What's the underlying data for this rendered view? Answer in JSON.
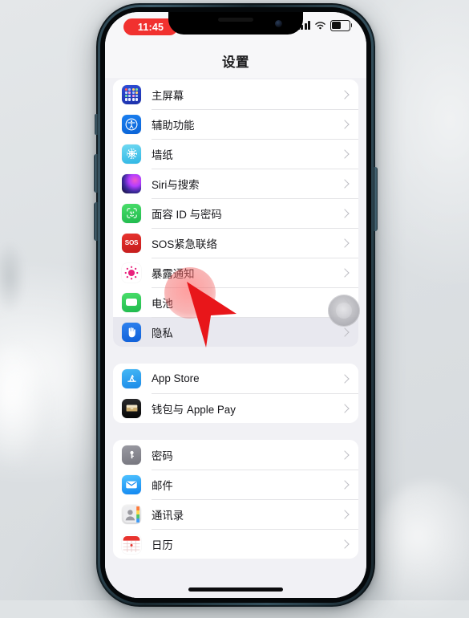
{
  "statusbar": {
    "time": "11:45",
    "time_pill_color": "#f1312f",
    "signal_icon": "cellular-signal-icon",
    "wifi_icon": "wifi-icon",
    "battery_icon": "battery-icon"
  },
  "navbar": {
    "title": "设置"
  },
  "groups": [
    {
      "name": "group-display",
      "rows": [
        {
          "label": "主屏幕",
          "icon": "home-screen-icon"
        },
        {
          "label": "辅助功能",
          "icon": "accessibility-icon"
        },
        {
          "label": "墙纸",
          "icon": "wallpaper-icon"
        },
        {
          "label": "Siri与搜索",
          "icon": "siri-icon"
        },
        {
          "label": "面容 ID 与密码",
          "icon": "face-id-icon"
        },
        {
          "label": "SOS紧急联络",
          "icon": "sos-icon"
        },
        {
          "label": "暴露通知",
          "icon": "exposure-notification-icon"
        },
        {
          "label": "电池",
          "icon": "battery-settings-icon"
        },
        {
          "label": "隐私",
          "icon": "privacy-icon",
          "pressed": true
        }
      ]
    },
    {
      "name": "group-store",
      "rows": [
        {
          "label": "App Store",
          "icon": "app-store-icon"
        },
        {
          "label": "钱包与 Apple Pay",
          "icon": "wallet-icon"
        }
      ]
    },
    {
      "name": "group-apps",
      "rows": [
        {
          "label": "密码",
          "icon": "passwords-icon"
        },
        {
          "label": "邮件",
          "icon": "mail-icon"
        },
        {
          "label": "通讯录",
          "icon": "contacts-icon"
        },
        {
          "label": "日历",
          "icon": "calendar-icon"
        }
      ]
    }
  ],
  "overlay": {
    "assistive_touch": "assistive-touch-button",
    "tap_ripple": "tap-ripple-indicator",
    "cursor": "mouse-cursor-pointer",
    "home_indicator": "home-indicator"
  },
  "device": {
    "frame": "iphone-frame",
    "buttons": [
      "mute-switch",
      "volume-up-button",
      "volume-down-button",
      "power-button"
    ]
  }
}
